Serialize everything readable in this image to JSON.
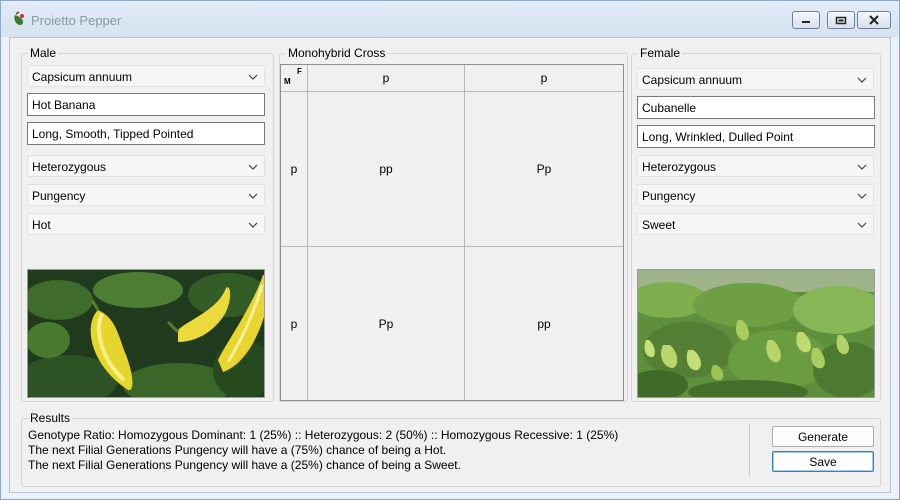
{
  "window": {
    "title": "Proietto Pepper"
  },
  "male": {
    "legend": "Male",
    "species": "Capsicum annuum",
    "name": "Hot Banana",
    "description": "Long, Smooth, Tipped Pointed",
    "zygosity": "Heterozygous",
    "trait": "Pungency",
    "phenotype": "Hot"
  },
  "cross": {
    "legend": "Monohybrid Cross",
    "corner_male": "M",
    "corner_female": "F",
    "female_alleles": [
      "p",
      "p"
    ],
    "male_alleles": [
      "p",
      "p"
    ],
    "cells": [
      [
        "pp",
        "Pp"
      ],
      [
        "Pp",
        "pp"
      ]
    ]
  },
  "female": {
    "legend": "Female",
    "species": "Capsicum annuum",
    "name": "Cubanelle",
    "description": "Long, Wrinkled, Dulled Point",
    "zygosity": "Heterozygous",
    "trait": "Pungency",
    "phenotype": "Sweet"
  },
  "results": {
    "legend": "Results",
    "lines": [
      "Genotype Ratio: Homozygous Dominant: 1 (25%) :: Heterozygous: 2 (50%) :: Homozygous Recessive: 1 (25%)",
      "The next Filial Generations Pungency will have a (75%) chance of being a Hot.",
      "The next Filial Generations Pungency will have a (25%) chance of being a Sweet."
    ]
  },
  "buttons": {
    "generate": "Generate",
    "save": "Save"
  }
}
